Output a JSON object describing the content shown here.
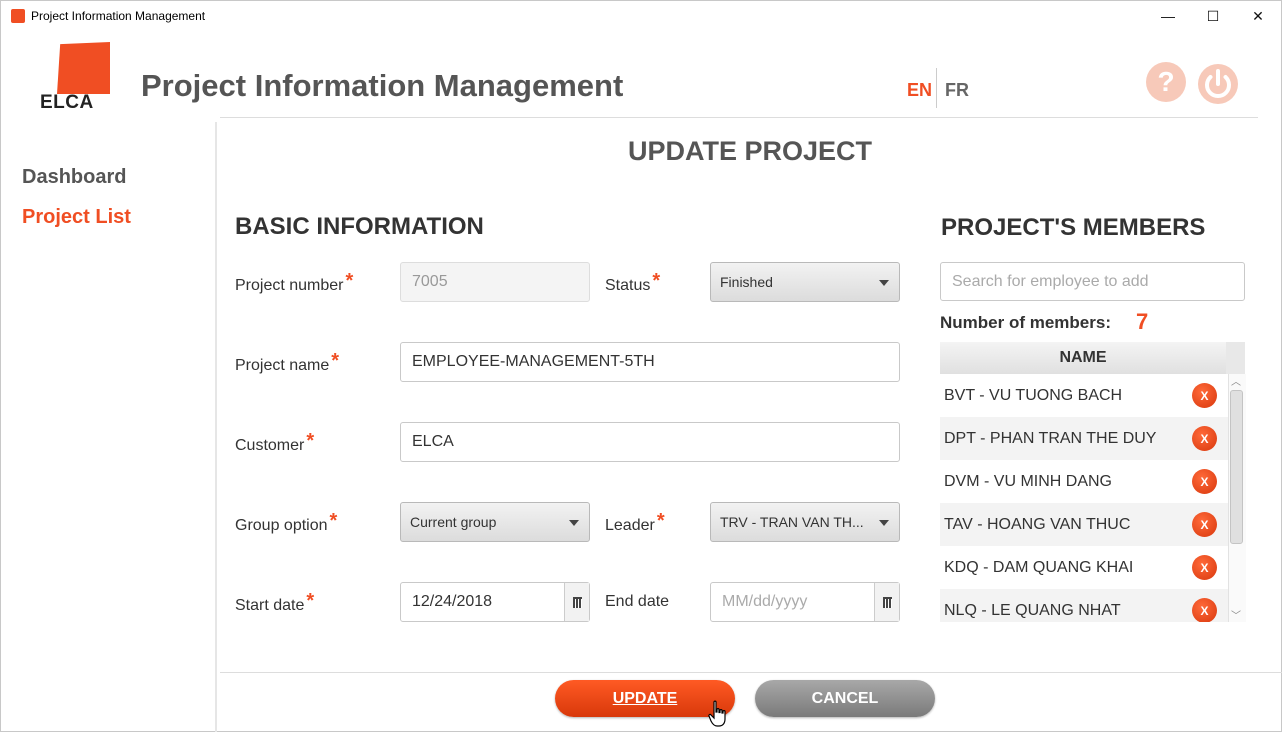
{
  "window": {
    "title": "Project Information Management",
    "minimize_glyph": "—",
    "maximize_glyph": "☐",
    "close_glyph": "✕"
  },
  "header": {
    "logo_text": "ELCA",
    "app_title": "Project Information Management",
    "lang_en": "EN",
    "lang_fr": "FR",
    "help_glyph": "?",
    "power_icon": "power-icon"
  },
  "sidebar": {
    "items": [
      {
        "label": "Dashboard",
        "active": false
      },
      {
        "label": "Project List",
        "active": true
      }
    ]
  },
  "page": {
    "title": "UPDATE PROJECT"
  },
  "basic": {
    "heading": "BASIC INFORMATION",
    "required_mark": "*",
    "project_number_label": "Project number",
    "project_number_value": "7005",
    "status_label": "Status",
    "status_value": "Finished",
    "project_name_label": "Project name",
    "project_name_value": "EMPLOYEE-MANAGEMENT-5TH",
    "customer_label": "Customer",
    "customer_value": "ELCA",
    "group_label": "Group option",
    "group_value": "Current group",
    "leader_label": "Leader",
    "leader_value": "TRV - TRAN VAN TH...",
    "start_label": "Start date",
    "start_value": "12/24/2018",
    "end_label": "End date",
    "end_placeholder": "MM/dd/yyyy"
  },
  "members": {
    "heading": "PROJECT'S MEMBERS",
    "search_placeholder": "Search for employee to add",
    "count_label": "Number of members:",
    "count_value": "7",
    "column_header": "NAME",
    "remove_glyph": "X",
    "rows": [
      "BVT - VU TUONG BACH",
      "DPT - PHAN TRAN THE DUY",
      "DVM - VU MINH DANG",
      "TAV - HOANG VAN THUC",
      "KDQ - DAM QUANG KHAI",
      "NLQ - LE QUANG NHAT"
    ]
  },
  "actions": {
    "update_label": "UPDATE",
    "cancel_label": "CANCEL"
  },
  "colors": {
    "accent": "#f04e23",
    "text": "#333333",
    "muted": "#555555"
  }
}
